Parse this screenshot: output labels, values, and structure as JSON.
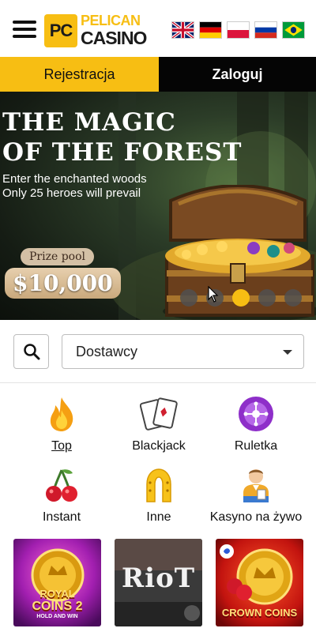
{
  "header": {
    "logo": {
      "badge": "PC",
      "line1": "PELICAN",
      "line2": "CASINO"
    },
    "menu_icon": "hamburger-menu-icon",
    "flags": [
      "flag-uk",
      "flag-germany",
      "flag-poland",
      "flag-russia",
      "flag-brazil"
    ]
  },
  "auth": {
    "register_label": "Rejestracja",
    "login_label": "Zaloguj"
  },
  "banner": {
    "title_line1": "THE MAGIC",
    "title_line2": "OF THE FOREST",
    "subtitle_line1": "Enter the enchanted woods",
    "subtitle_line2": "Only 25 heroes will prevail",
    "prize_label": "Prize pool",
    "prize_amount": "$10,000",
    "slides_total": 5,
    "active_slide": 3
  },
  "search": {
    "icon": "search-icon",
    "provider_select": "Dostawcy"
  },
  "categories": [
    {
      "label": "Top",
      "icon": "fire-icon"
    },
    {
      "label": "Blackjack",
      "icon": "playing-cards-icon"
    },
    {
      "label": "Ruletka",
      "icon": "roulette-icon"
    },
    {
      "label": "Instant",
      "icon": "cherries-icon"
    },
    {
      "label": "Inne",
      "icon": "horseshoe-icon"
    },
    {
      "label": "Kasyno na żywo",
      "icon": "live-dealer-icon"
    }
  ],
  "games": [
    {
      "name_line1": "ROYAL",
      "name_line2": "COINS 2",
      "tagline": "HOLD AND WIN"
    },
    {
      "name": "RioT"
    },
    {
      "name": "CROWN COINS"
    }
  ],
  "colors": {
    "accent": "#f7be13",
    "dark": "#050505",
    "roulette": "#8e2fc9"
  }
}
